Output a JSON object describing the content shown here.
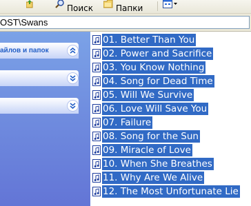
{
  "toolbar": {
    "search_label": "Поиск",
    "folders_label": "Папки"
  },
  "address": {
    "value": "OST\\Swans"
  },
  "task_pane": {
    "sections": [
      {
        "title": "айлов и папок"
      },
      {
        "title": ""
      },
      {
        "title": ""
      }
    ]
  },
  "files": {
    "items": [
      {
        "label": "01. Better Than You"
      },
      {
        "label": "02. Power and Sacrifice"
      },
      {
        "label": "03. You Know Nothing"
      },
      {
        "label": "04. Song for Dead Time"
      },
      {
        "label": "05. Will We Survive"
      },
      {
        "label": "06. Love Will Save You"
      },
      {
        "label": "07. Failure"
      },
      {
        "label": "08. Song for the Sun"
      },
      {
        "label": "09. Miracle of Love"
      },
      {
        "label": "10. When She Breathes"
      },
      {
        "label": "11. Why Are We Alive"
      },
      {
        "label": "12. The Most Unfortunate Lie"
      }
    ],
    "selection_color": "#316ac5"
  }
}
